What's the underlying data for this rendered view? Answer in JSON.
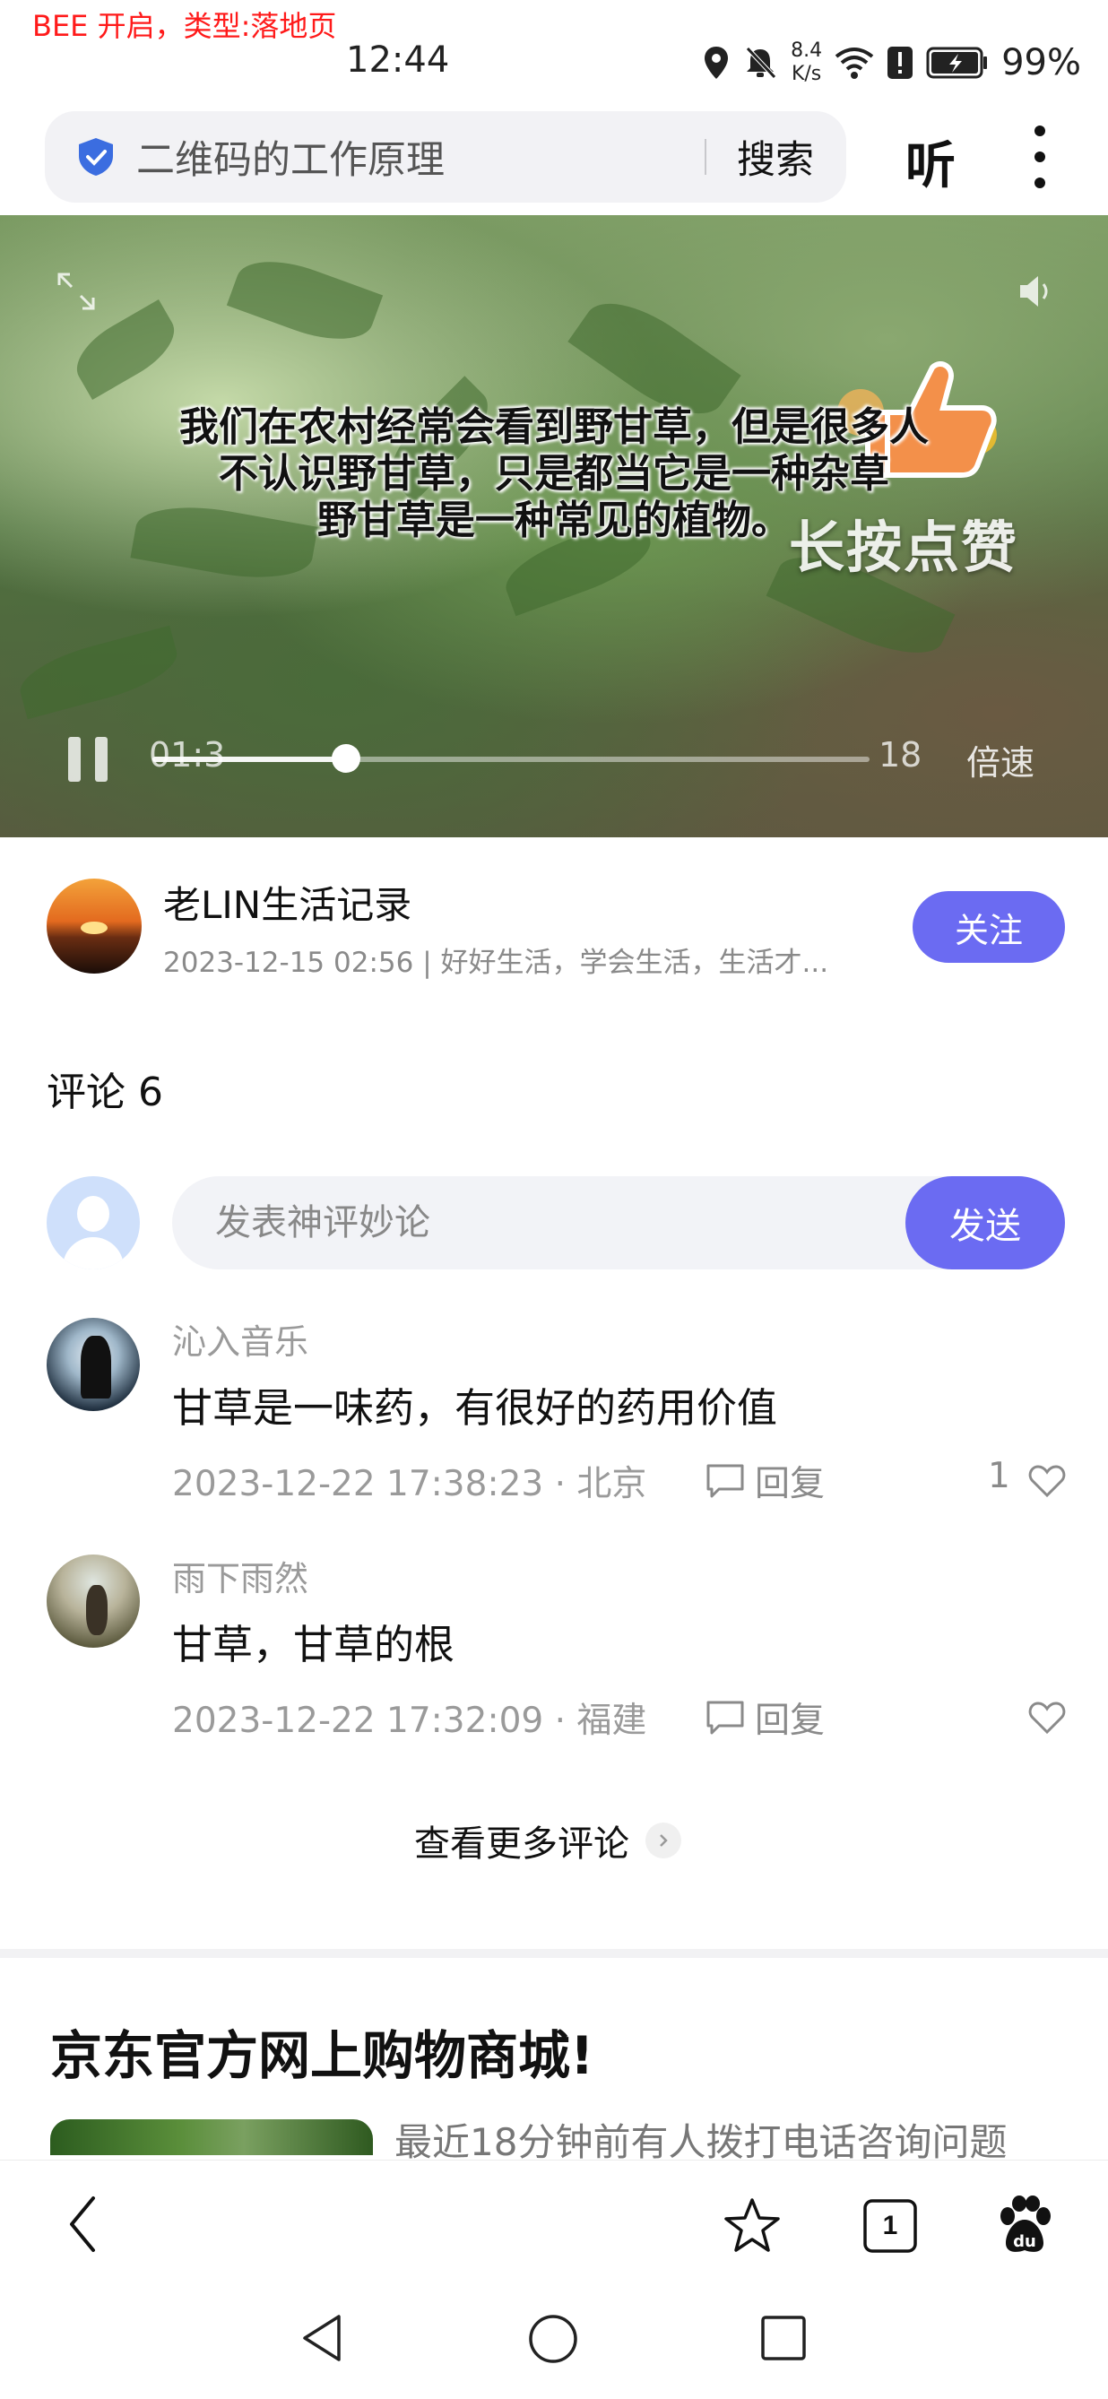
{
  "status_bar": {
    "debug_label": "BEE 开启，类型:落地页",
    "time": "12:44",
    "net_speed_value": "8.4",
    "net_speed_unit": "K/s",
    "battery": "99%"
  },
  "search": {
    "query": "二维码的工作原理",
    "button_label": "搜索",
    "listen_label": "听"
  },
  "video": {
    "like_hint": "长按点赞",
    "subtitle_line1": "我们在农村经常会看到野甘草，但是很多人",
    "subtitle_line2": "不认识野甘草，只是都当它是一种杂草",
    "subtitle_line3": "野甘草是一种常见的植物。",
    "time_current": "01:3",
    "time_total": "18",
    "speed_label": "倍速",
    "progress": 0.27
  },
  "author": {
    "name": "老LIN生活记录",
    "meta": "2023-12-15 02:56 | 好好生活，学会生活，生活才...",
    "follow_label": "关注"
  },
  "comments": {
    "heading": "评论 6",
    "input_placeholder": "发表神评妙论",
    "send_label": "发送",
    "items": [
      {
        "user": "沁入音乐",
        "text": "甘草是一味药，有很好的药用价值",
        "meta": "2023-12-22 17:38:23 · 北京",
        "reply_label": "回复",
        "likes": "1"
      },
      {
        "user": "雨下雨然",
        "text": "甘草，甘草的根",
        "meta": "2023-12-22 17:32:09 · 福建",
        "reply_label": "回复",
        "likes": ""
      }
    ],
    "more_label": "查看更多评论"
  },
  "ad": {
    "title": "京东官方网上购物商城!",
    "text": "最近18分钟前有人拨打电话咨询问题"
  },
  "bottom_nav": {
    "tab_count": "1"
  },
  "colors": {
    "accent": "#6b6bf2",
    "shield": "#3b6de0",
    "debug_label": "#ff1a1a"
  },
  "icons": {
    "shield": "shield-check-icon",
    "fullscreen": "expand-icon",
    "volume": "speaker-icon",
    "like_sticker": "thumbs-up-icon",
    "reply": "comment-bubble-icon",
    "like": "heart-icon",
    "back": "chevron-left-icon",
    "bookmark": "star-icon",
    "tabs": "tabs-square-icon",
    "brand": "baidu-paw-icon",
    "system_back": "triangle-back-icon",
    "system_home": "circle-home-icon",
    "system_recent": "square-recent-icon"
  }
}
